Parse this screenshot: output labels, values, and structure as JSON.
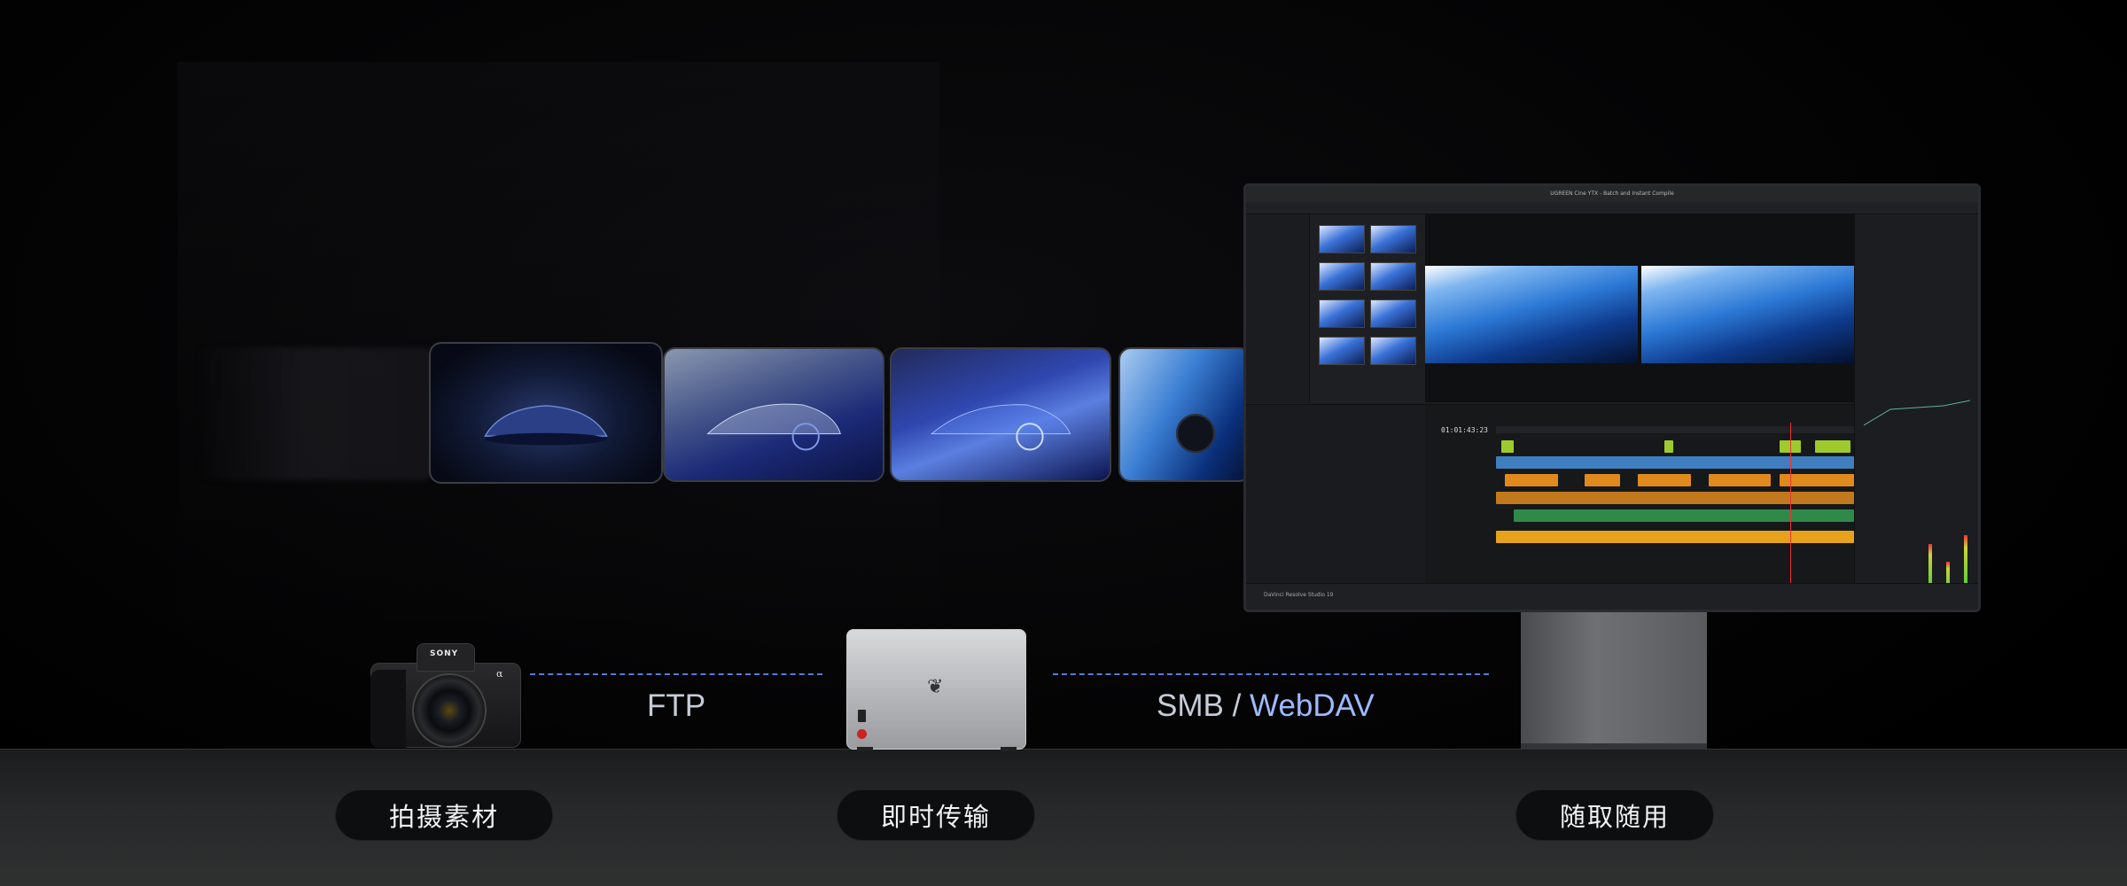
{
  "flow": {
    "protocol_left": "FTP",
    "protocol_right_a": "SMB",
    "protocol_right_sep": " / ",
    "protocol_right_b": "WebDAV"
  },
  "steps": [
    {
      "label": "拍摄素材",
      "icon": "camera-icon"
    },
    {
      "label": "即时传输",
      "icon": "nas-icon"
    },
    {
      "label": "随取随用",
      "icon": "monitor-icon"
    }
  ],
  "camera": {
    "brand": "SONY",
    "model": "α"
  },
  "editor": {
    "window_title": "UGREEN Cine YTX - Batch and Instant Compile",
    "timecode": "01:01:43:23",
    "brand": "DaVinci Resolve Studio 19"
  },
  "colors": {
    "accent_dash": "#5b7ad6",
    "accent_text": "#9fb9ff",
    "clip_green": "#9ecb2b",
    "clip_blue": "#3f7fbf",
    "clip_orange": "#e08a1e",
    "clip_audio_green": "#2f8a4a",
    "nas_led": "#cc2222"
  }
}
